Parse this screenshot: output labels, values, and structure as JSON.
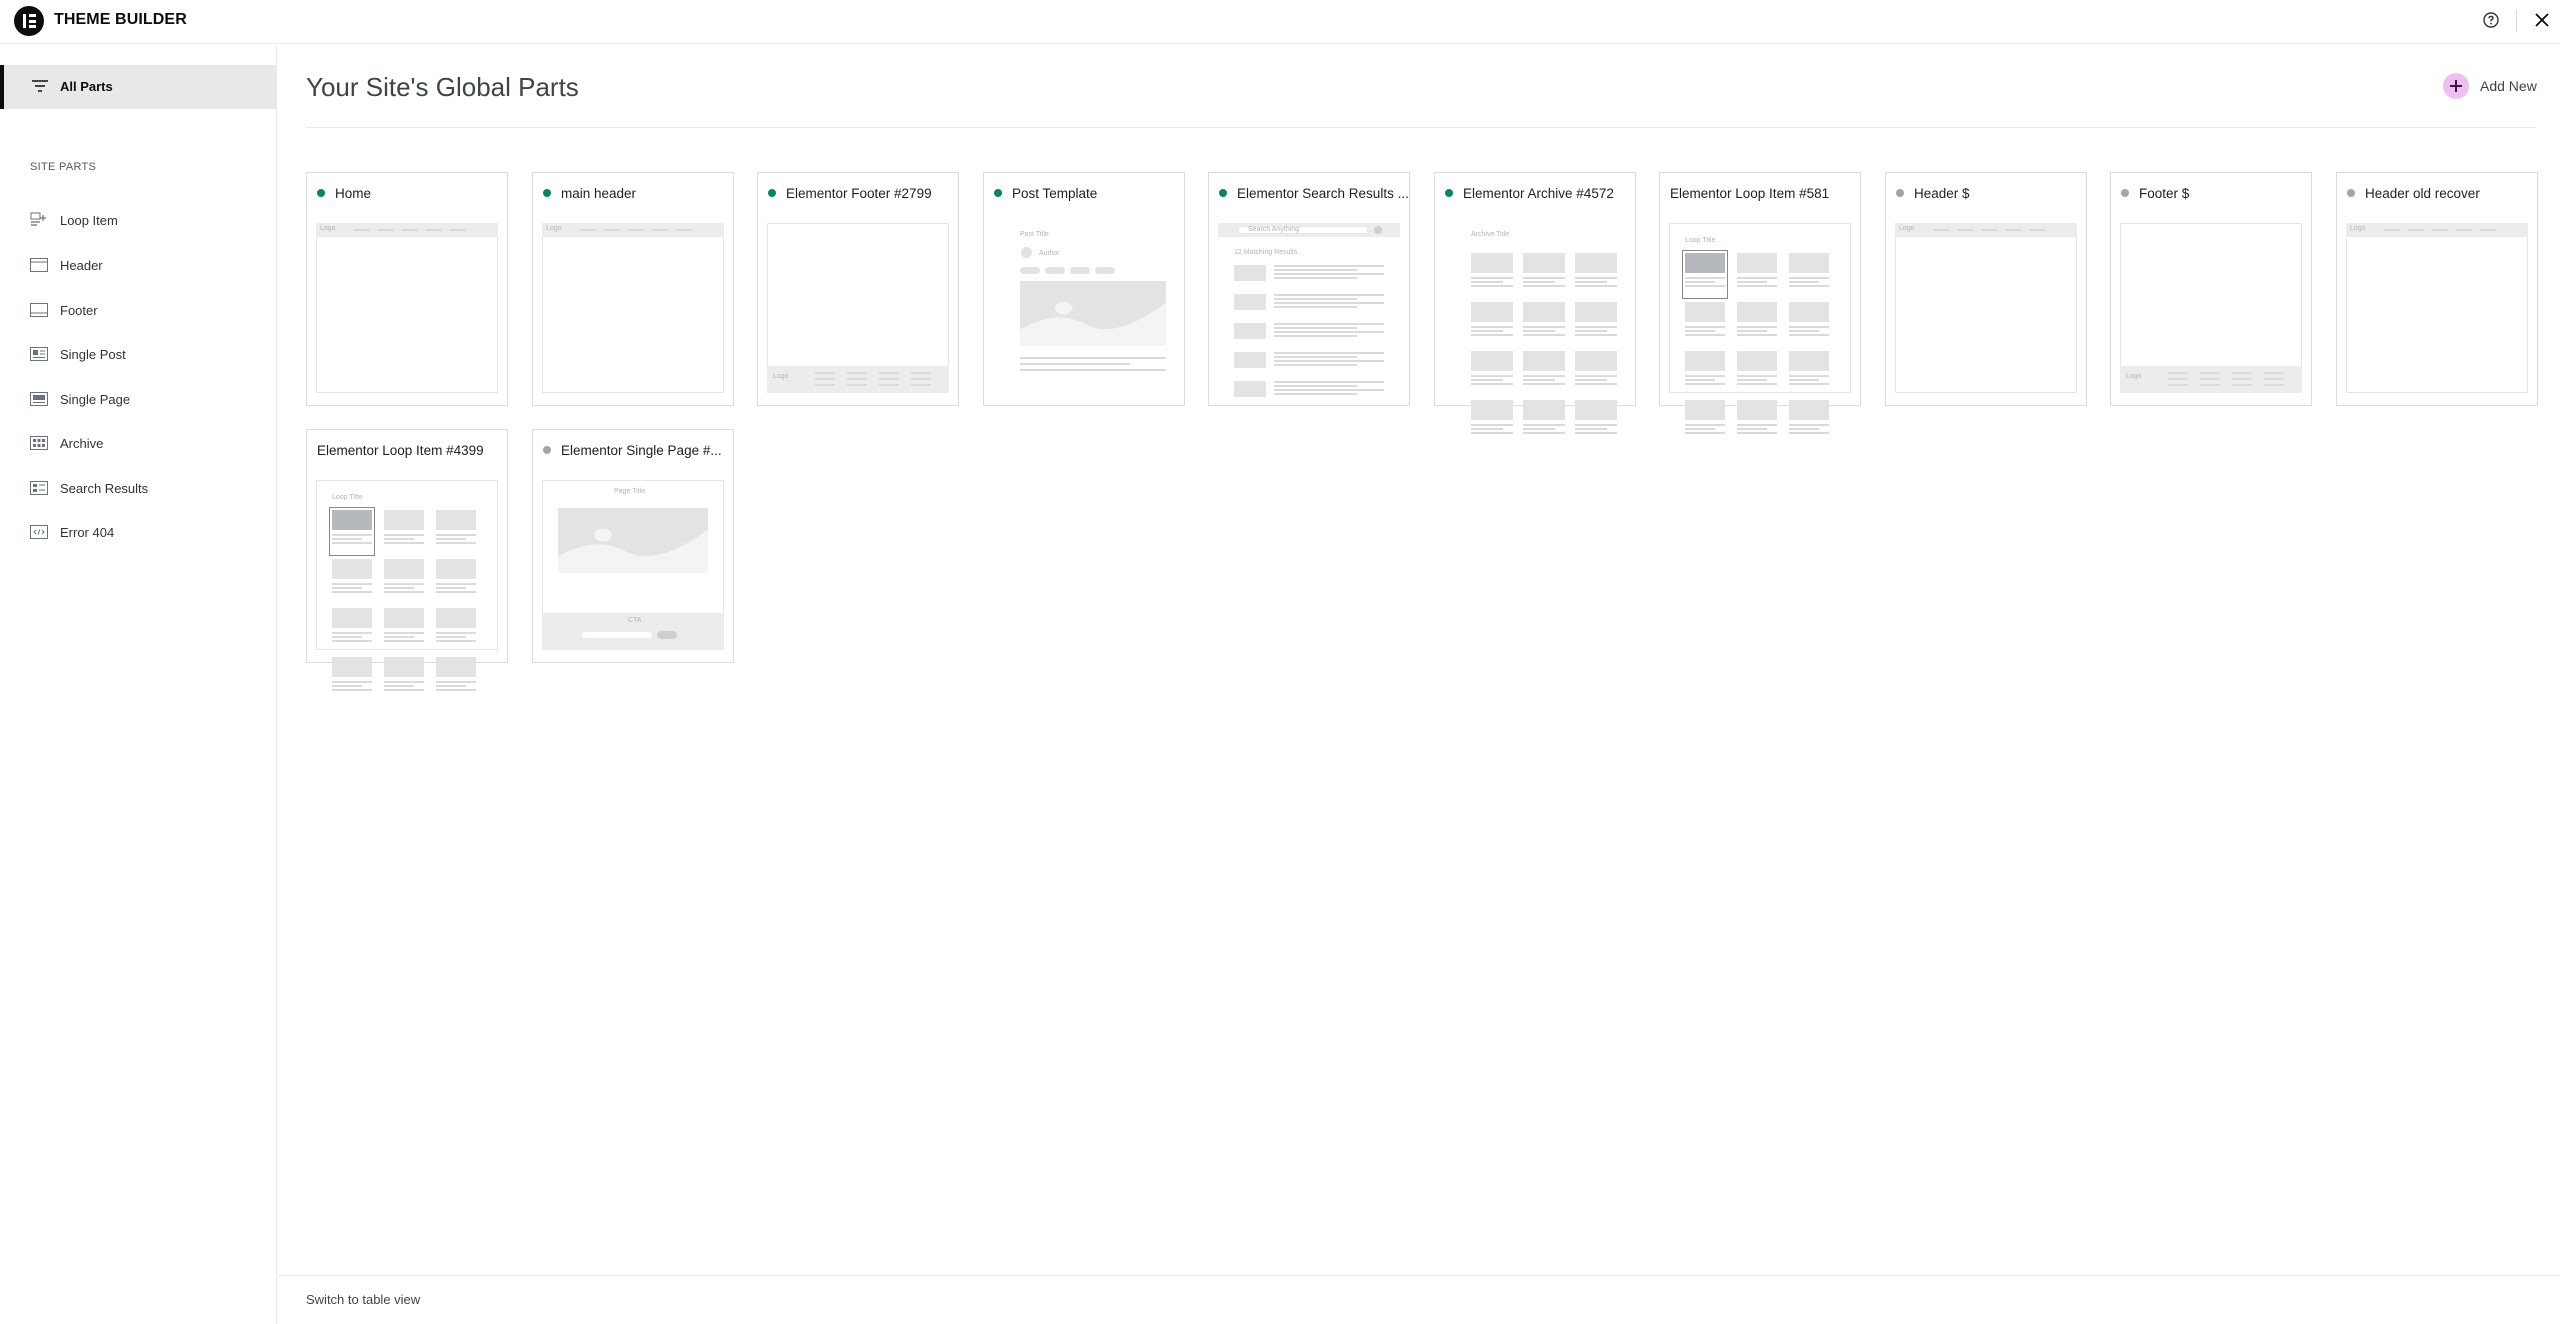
{
  "app": {
    "title": "THEME BUILDER"
  },
  "sidebar": {
    "all_parts_label": "All Parts",
    "section_title": "SITE PARTS",
    "items": [
      {
        "label": "Loop Item",
        "icon": "loop-item-icon"
      },
      {
        "label": "Header",
        "icon": "header-icon"
      },
      {
        "label": "Footer",
        "icon": "footer-icon"
      },
      {
        "label": "Single Post",
        "icon": "single-post-icon"
      },
      {
        "label": "Single Page",
        "icon": "single-page-icon"
      },
      {
        "label": "Archive",
        "icon": "archive-icon"
      },
      {
        "label": "Search Results",
        "icon": "search-results-icon"
      },
      {
        "label": "Error 404",
        "icon": "error-404-icon"
      }
    ]
  },
  "main": {
    "title": "Your Site's Global Parts",
    "add_new_label": "Add New",
    "switch_view_label": "Switch to table view"
  },
  "colors": {
    "active": "#0a875a",
    "inactive": "#a4a4a4",
    "accent": "#eec0f0"
  },
  "cards": [
    {
      "name": "Home",
      "status": "active",
      "thumb": "header",
      "logo_text": "Logo"
    },
    {
      "name": "main header",
      "status": "active",
      "thumb": "header",
      "logo_text": "Logo"
    },
    {
      "name": "Elementor Footer #2799",
      "status": "active",
      "thumb": "footer",
      "logo_text": "Logo"
    },
    {
      "name": "Post Template",
      "status": "active",
      "thumb": "post",
      "title_text": "Post Title",
      "author_text": "Author"
    },
    {
      "name": "Elementor Search Results ...",
      "status": "active",
      "thumb": "search",
      "search_text": "Search Anything",
      "results_text": "12 Matching Results"
    },
    {
      "name": "Elementor Archive #4572",
      "status": "active",
      "thumb": "archive",
      "title_text": "Archive Title"
    },
    {
      "name": "Elementor Loop Item #581",
      "status": "none",
      "thumb": "loop",
      "title_text": "Loop Title"
    },
    {
      "name": "Header $",
      "status": "inactive",
      "thumb": "header",
      "logo_text": "Logo"
    },
    {
      "name": "Footer $",
      "status": "inactive",
      "thumb": "footer",
      "logo_text": "Logo"
    },
    {
      "name": "Header old recover",
      "status": "inactive",
      "thumb": "header",
      "logo_text": "Logo"
    },
    {
      "name": "Elementor Loop Item #4399",
      "status": "none",
      "thumb": "loop",
      "title_text": "Loop Title"
    },
    {
      "name": "Elementor Single Page #...",
      "status": "inactive",
      "thumb": "page",
      "title_text": "Page Title",
      "cta_text": "CTA"
    }
  ]
}
